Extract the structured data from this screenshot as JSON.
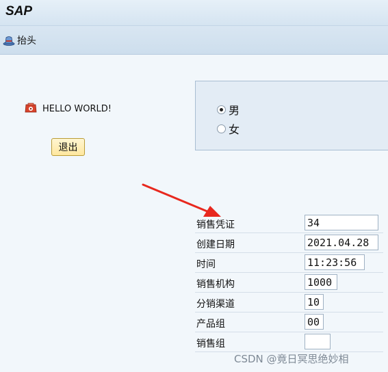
{
  "app": {
    "title": "SAP"
  },
  "toolbar": {
    "head_label": "抬头"
  },
  "main": {
    "hello_text": "HELLO WORLD!",
    "exit_label": "退出"
  },
  "gender": {
    "options": [
      {
        "label": "男",
        "checked": true
      },
      {
        "label": "女",
        "checked": false
      }
    ]
  },
  "form": {
    "rows": [
      {
        "label": "销售凭证",
        "value": "34"
      },
      {
        "label": "创建日期",
        "value": "2021.04.28"
      },
      {
        "label": "时间",
        "value": "11:23:56"
      },
      {
        "label": "销售机构",
        "value": "1000"
      },
      {
        "label": "分销渠道",
        "value": "10"
      },
      {
        "label": "产品组",
        "value": "00"
      },
      {
        "label": "销售组",
        "value": ""
      }
    ]
  },
  "watermark": "CSDN @竟日冥思绝妙相",
  "colors": {
    "arrow": "#e8281e",
    "button": "#ffe79e"
  }
}
